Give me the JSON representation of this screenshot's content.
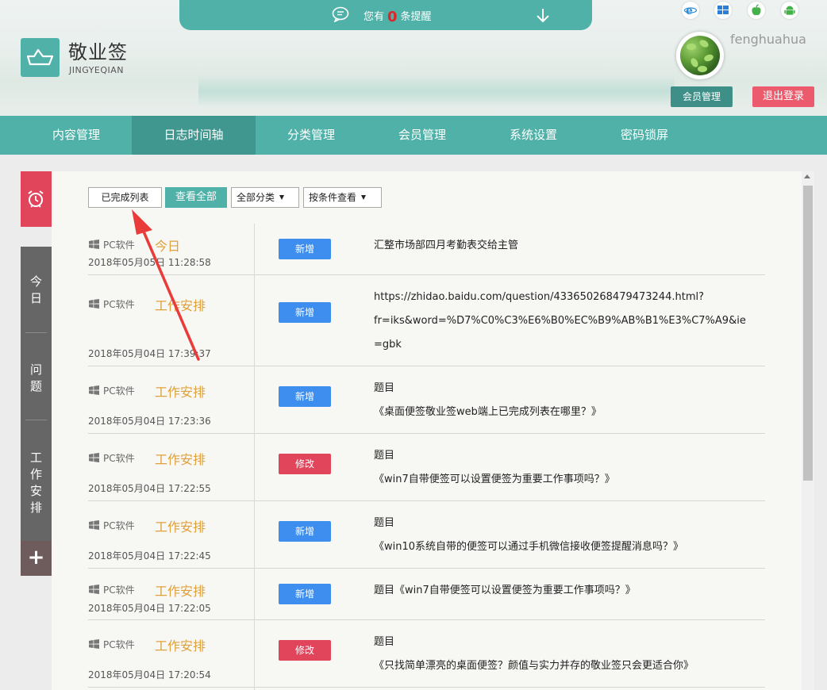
{
  "notice": {
    "prefix": "您有",
    "count": "0",
    "suffix": "条提醒"
  },
  "brand": {
    "name": "敬业签",
    "sub": "JINGYEQIAN"
  },
  "platforms": [
    "ie-icon",
    "windows-icon",
    "apple-icon",
    "android-icon"
  ],
  "user": {
    "name": "fenghuahua",
    "member_btn": "会员管理",
    "logout_btn": "退出登录"
  },
  "nav": [
    {
      "label": "内容管理"
    },
    {
      "label": "日志时间轴"
    },
    {
      "label": "分类管理"
    },
    {
      "label": "会员管理"
    },
    {
      "label": "系统设置"
    },
    {
      "label": "密码锁屏"
    }
  ],
  "sidebar": {
    "tabs": [
      {
        "label": "今日"
      },
      {
        "label": "问题"
      },
      {
        "label": "工作安排"
      }
    ],
    "add": "+"
  },
  "toolbar": {
    "completed": "已完成列表",
    "view_all": "查看全部",
    "category_select": "全部分类",
    "filter_select": "按条件查看"
  },
  "entries": [
    {
      "source": "PC软件",
      "category": "今日",
      "time": "2018年05月05日 11:28:58",
      "tag": "新增",
      "lines": [
        "汇整市场部四月考勤表交给主管"
      ]
    },
    {
      "source": "PC软件",
      "category": "工作安排",
      "time": "2018年05月04日 17:39:37",
      "tag": "新增",
      "lines": [
        "https://zhidao.baidu.com/question/433650268479473244.html?",
        "fr=iks&word=%D7%C0%C3%E6%B0%EC%B9%AB%B1%E3%C7%A9&ie",
        "=gbk"
      ]
    },
    {
      "source": "PC软件",
      "category": "工作安排",
      "time": "2018年05月04日 17:23:36",
      "tag": "新增",
      "lines": [
        "题目",
        "《桌面便签敬业签web端上已完成列表在哪里？》"
      ]
    },
    {
      "source": "PC软件",
      "category": "工作安排",
      "time": "2018年05月04日 17:22:55",
      "tag": "修改",
      "lines": [
        "题目",
        "《win7自带便签可以设置便签为重要工作事项吗？》"
      ]
    },
    {
      "source": "PC软件",
      "category": "工作安排",
      "time": "2018年05月04日 17:22:45",
      "tag": "新增",
      "lines": [
        "题目",
        "《win10系统自带的便签可以通过手机微信接收便签提醒消息吗？》"
      ]
    },
    {
      "source": "PC软件",
      "category": "工作安排",
      "time": "2018年05月04日 17:22:05",
      "tag": "新增",
      "lines": [
        "题目《win7自带便签可以设置便签为重要工作事项吗？》"
      ]
    },
    {
      "source": "PC软件",
      "category": "工作安排",
      "time": "2018年05月04日 17:20:54",
      "tag": "修改",
      "lines": [
        "题目",
        "《只找简单漂亮的桌面便签？颜值与实力并存的敬业签只会更适合你》"
      ]
    }
  ],
  "colors": {
    "teal": "#4fb1a8",
    "add": "#3e8ef0",
    "edit": "#e0455c",
    "category": "#e0a03b",
    "annotation": "#ea3b3b"
  }
}
